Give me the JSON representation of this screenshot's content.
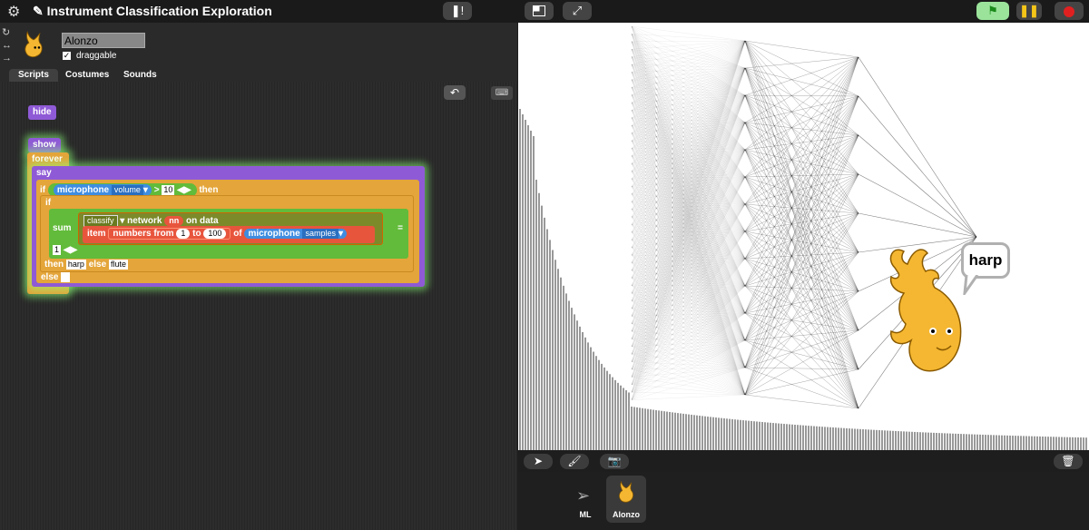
{
  "topbar": {
    "title": "Instrument Classification Exploration",
    "title_icon": "pencil-icon",
    "settings_icon": "gear-icon",
    "cloud_icon": "footprints-icon",
    "stage_size_icon": "normal-stage-icon",
    "stage_expand_icon": "fullscreen-icon",
    "green_flag_icon": "green-flag-icon",
    "pause_icon": "pause-icon",
    "stop_icon": "stop-icon"
  },
  "sprite": {
    "name": "Alonzo",
    "draggable_label": "draggable",
    "draggable_checked": "✓"
  },
  "tabs": [
    "Scripts",
    "Costumes",
    "Sounds"
  ],
  "script": {
    "hide": "hide",
    "show": "show",
    "forever": "forever",
    "say": "say",
    "if": "if",
    "then": "then",
    "else": "else",
    "microphone": "microphone",
    "volume": "volume",
    "gt": ">",
    "threshold": "10",
    "sum": "sum",
    "classify": "classify",
    "network": "network",
    "nn": "nn",
    "on_data": "on data",
    "item": "item",
    "numbers_from": "numbers from",
    "from_val": "1",
    "to": "to",
    "to_val": "100",
    "of": "of",
    "samples": "samples",
    "equals": "=",
    "compare_val": "1",
    "then_val": "harp",
    "else_val": "flute"
  },
  "stage": {
    "speech": "harp"
  },
  "corral": {
    "items": [
      {
        "label": "ML"
      },
      {
        "label": "Alonzo"
      }
    ]
  },
  "colors": {
    "looks": "#8f5ad6",
    "control": "#e4a53a",
    "operators": "#62bb3a",
    "sensing": "#3f8de0",
    "variables": "#e8553d"
  }
}
